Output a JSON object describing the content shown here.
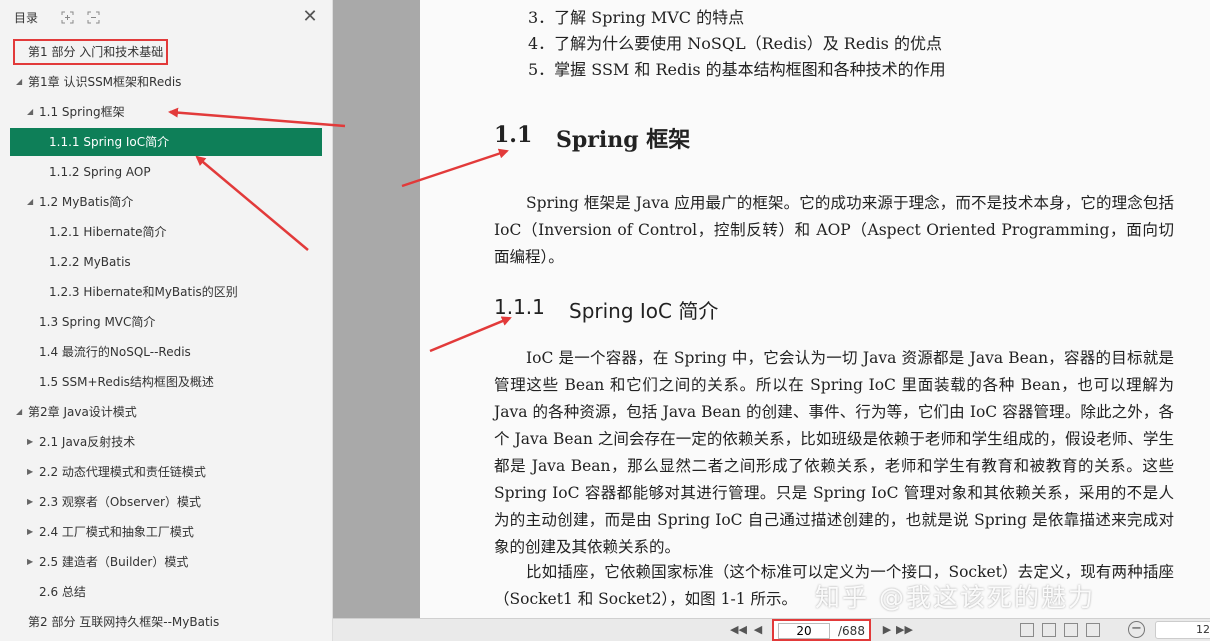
{
  "sidebar": {
    "title": "目录",
    "toc": [
      {
        "label": "第1 部分 入门和技术基础",
        "level": 0,
        "arrow": "",
        "highlight": true
      },
      {
        "label": "第1章 认识SSM框架和Redis",
        "level": 0,
        "arrow": "down"
      },
      {
        "label": "1.1 Spring框架",
        "level": 1,
        "arrow": "down"
      },
      {
        "label": "1.1.1 Spring IoC简介",
        "level": 2,
        "arrow": "",
        "selected": true
      },
      {
        "label": "1.1.2 Spring AOP",
        "level": 2,
        "arrow": ""
      },
      {
        "label": "1.2 MyBatis简介",
        "level": 1,
        "arrow": "down"
      },
      {
        "label": "1.2.1 Hibernate简介",
        "level": 2,
        "arrow": ""
      },
      {
        "label": "1.2.2 MyBatis",
        "level": 2,
        "arrow": ""
      },
      {
        "label": "1.2.3 Hibernate和MyBatis的区别",
        "level": 2,
        "arrow": ""
      },
      {
        "label": "1.3 Spring MVC简介",
        "level": 1,
        "arrow": ""
      },
      {
        "label": "1.4 最流行的NoSQL--Redis",
        "level": 1,
        "arrow": ""
      },
      {
        "label": "1.5 SSM+Redis结构框图及概述",
        "level": 1,
        "arrow": ""
      },
      {
        "label": "第2章 Java设计模式",
        "level": 0,
        "arrow": "down"
      },
      {
        "label": "2.1 Java反射技术",
        "level": 1,
        "arrow": "right"
      },
      {
        "label": "2.2 动态代理模式和责任链模式",
        "level": 1,
        "arrow": "right"
      },
      {
        "label": "2.3 观察者（Observer）模式",
        "level": 1,
        "arrow": "right"
      },
      {
        "label": "2.4 工厂模式和抽象工厂模式",
        "level": 1,
        "arrow": "right"
      },
      {
        "label": "2.5 建造者（Builder）模式",
        "level": 1,
        "arrow": "right"
      },
      {
        "label": "2.6 总结",
        "level": 1,
        "arrow": ""
      },
      {
        "label": "第2 部分 互联网持久框架--MyBatis",
        "level": 0,
        "arrow": ""
      }
    ]
  },
  "page": {
    "goals": [
      "3．了解 Spring MVC 的特点",
      "4．了解为什么要使用 NoSQL（Redis）及 Redis 的优点",
      "5．掌握 SSM 和 Redis 的基本结构框图和各种技术的作用"
    ],
    "section_number": "1.1",
    "section_title": "Spring 框架",
    "section_para": "Spring 框架是 Java 应用最广的框架。它的成功来源于理念，而不是技术本身，它的理念包括 IoC（Inversion of Control，控制反转）和 AOP（Aspect Oriented Programming，面向切面编程）。",
    "subsection_number": "1.1.1",
    "subsection_title": "Spring IoC 简介",
    "para1": "IoC 是一个容器，在 Spring 中，它会认为一切 Java 资源都是 Java Bean，容器的目标就是管理这些 Bean 和它们之间的关系。所以在 Spring IoC 里面装载的各种 Bean，也可以理解为 Java 的各种资源，包括 Java Bean 的创建、事件、行为等，它们由 IoC 容器管理。除此之外，各个 Java Bean 之间会存在一定的依赖关系，比如班级是依赖于老师和学生组成的，假设老师、学生都是 Java Bean，那么显然二者之间形成了依赖关系，老师和学生有教育和被教育的关系。这些 Spring IoC 容器都能够对其进行管理。只是 Spring IoC 管理对象和其依赖关系，采用的不是人为的主动创建，而是由 Spring IoC 自己通过描述创建的，也就是说 Spring 是依靠描述来完成对象的创建及其依赖关系的。",
    "para2": "比如插座，它依赖国家标准（这个标准可以定义为一个接口，Socket）去定义，现有两种插座（Socket1 和 Socket2），如图 1-1 所示。",
    "watermark": "知乎 @我这该死的魅力"
  },
  "bottombar": {
    "current_page": "20",
    "total_pages": "/688",
    "zoom": "12"
  },
  "colors": {
    "selected": "#0e7f58",
    "annotation": "#e23a3a"
  }
}
